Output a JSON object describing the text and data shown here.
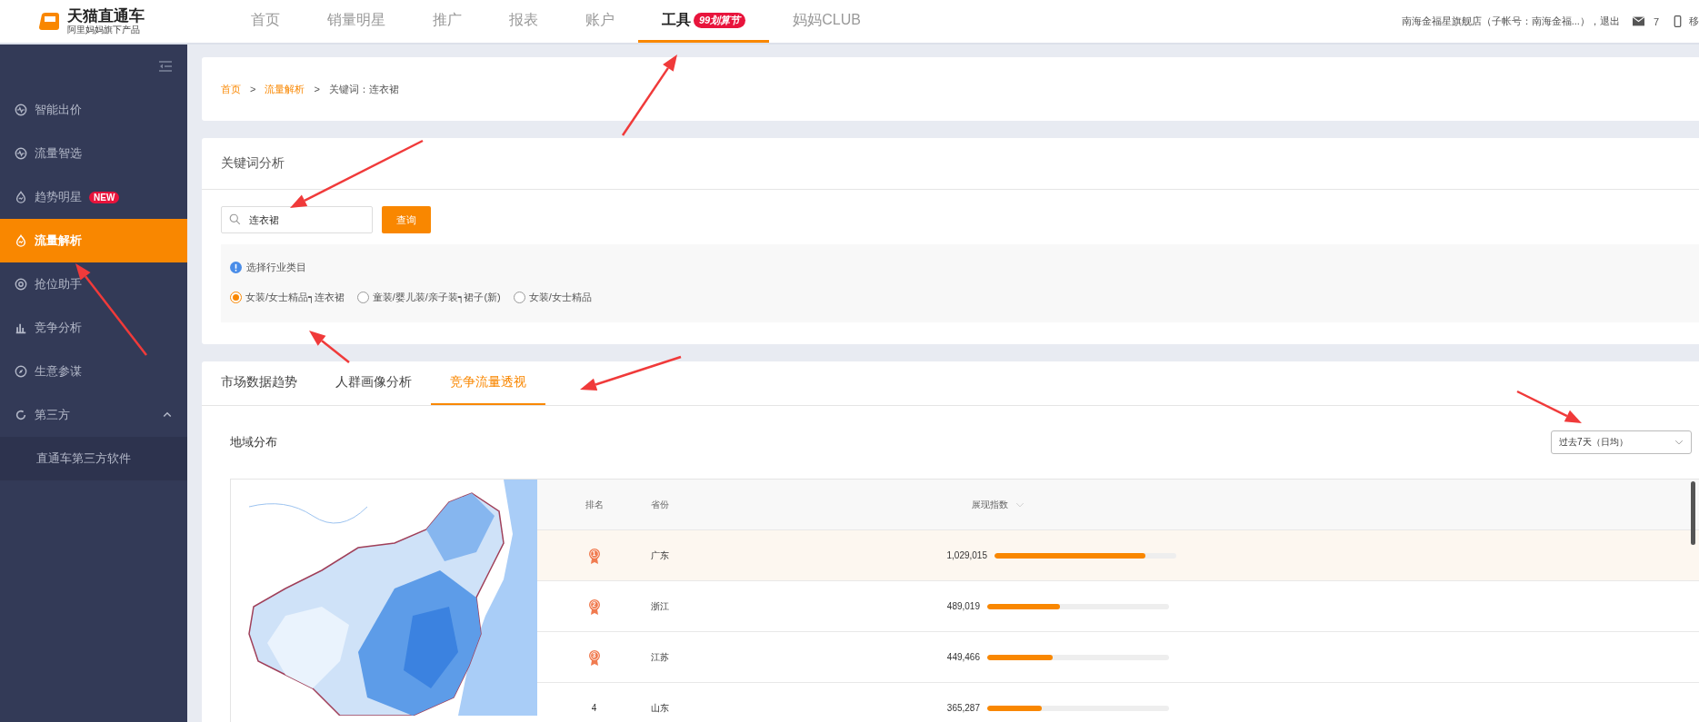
{
  "logo": {
    "title": "天猫直通车",
    "subtitle": "阿里妈妈旗下产品"
  },
  "nav": [
    {
      "label": "首页",
      "selected": false
    },
    {
      "label": "销量明星",
      "selected": false
    },
    {
      "label": "推广",
      "selected": false
    },
    {
      "label": "报表",
      "selected": false
    },
    {
      "label": "账户",
      "selected": false
    },
    {
      "label": "工具",
      "selected": true,
      "badge": "99划算节"
    },
    {
      "label": "妈妈CLUB",
      "selected": false
    }
  ],
  "account": {
    "text": "南海金福星旗舰店（子帐号：南海金福...），退出",
    "messages": "7",
    "mobile": "移"
  },
  "sidebar": {
    "items": [
      {
        "label": "智能出价",
        "selected": false
      },
      {
        "label": "流量智选",
        "selected": false
      },
      {
        "label": "趋势明星",
        "selected": false,
        "badge": "NEW"
      },
      {
        "label": "流量解析",
        "selected": true
      },
      {
        "label": "抢位助手",
        "selected": false
      },
      {
        "label": "竞争分析",
        "selected": false
      },
      {
        "label": "生意参谋",
        "selected": false
      },
      {
        "label": "第三方",
        "selected": false,
        "expanded": true,
        "children": [
          {
            "label": "直通车第三方软件",
            "selected": false
          }
        ]
      }
    ]
  },
  "breadcrumb": [
    {
      "label": "首页",
      "kind": "link"
    },
    {
      "label": ">",
      "kind": "sep"
    },
    {
      "label": "流量解析",
      "kind": "link"
    },
    {
      "label": ">",
      "kind": "sep"
    },
    {
      "label": "关键词：连衣裙",
      "kind": "current"
    }
  ],
  "keyword_panel": {
    "title": "关键词分析",
    "search": {
      "value": "连衣裙"
    },
    "button": "查询",
    "category_title": "选择行业类目",
    "categories": [
      {
        "label": "女装/女士精品┑连衣裙",
        "selected": true
      },
      {
        "label": "童装/婴儿装/亲子装┑裙子(新)",
        "selected": false
      },
      {
        "label": "女装/女士精品",
        "selected": false
      }
    ]
  },
  "tabs": [
    {
      "label": "市场数据趋势",
      "selected": false
    },
    {
      "label": "人群画像分析",
      "selected": false
    },
    {
      "label": "竞争流量透视",
      "selected": true
    }
  ],
  "region": {
    "title": "地域分布",
    "period": "过去7天（日均）",
    "columns": [
      "排名",
      "省份",
      "展现指数"
    ],
    "rows": [
      {
        "rank": "1",
        "kind": "medal",
        "province": "广东",
        "index": "1,029,015",
        "level": 0.83,
        "selected": true
      },
      {
        "rank": "2",
        "kind": "medal",
        "province": "浙江",
        "index": "489,019",
        "level": 0.4,
        "selected": false
      },
      {
        "rank": "3",
        "kind": "medal",
        "province": "江苏",
        "index": "449,466",
        "level": 0.36,
        "selected": false
      },
      {
        "rank": "4",
        "kind": "number",
        "province": "山东",
        "index": "365,287",
        "level": 0.3,
        "selected": false
      }
    ]
  }
}
